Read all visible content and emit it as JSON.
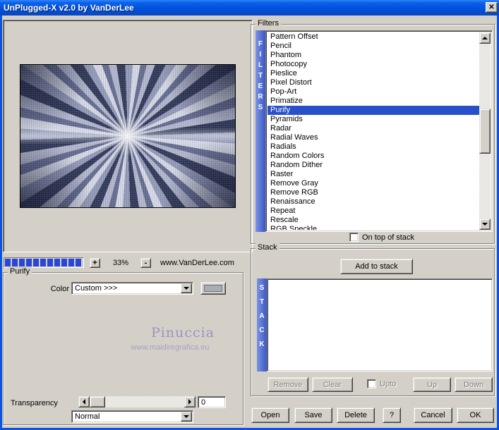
{
  "window": {
    "title": "UnPlugged-X v2.0 by VanDerLee",
    "close_icon": "✕"
  },
  "preview": {
    "zoom_in_label": "+",
    "zoom_level": "33%",
    "zoom_out_label": "-",
    "website": "www.VanDerLee.com"
  },
  "purify_panel": {
    "legend": "Purify",
    "color_label": "Color",
    "color_value": "Custom >>>",
    "watermark_title": "Pinuccia",
    "watermark_url": "www.maidiregrafica.eu",
    "transparency_label": "Transparency",
    "transparency_value": "0",
    "blend_mode": "Normal"
  },
  "filters_panel": {
    "legend": "Filters",
    "vertical_label": "FILTERS",
    "items": [
      "Pattern Offset",
      "Pencil",
      "Phantom",
      "Photocopy",
      "Pieslice",
      "Pixel Distort",
      "Pop-Art",
      "Primatize",
      "Purify",
      "Pyramids",
      "Radar",
      "Radial Waves",
      "Radials",
      "Random Colors",
      "Random Dither",
      "Raster",
      "Remove Gray",
      "Remove RGB",
      "Renaissance",
      "Repeat",
      "Rescale",
      "RGB Speckle"
    ],
    "selected": "Purify",
    "on_top_label": "On top of stack"
  },
  "stack_panel": {
    "legend": "Stack",
    "add_button": "Add to stack",
    "vertical_label": "STACK",
    "remove_button": "Remove",
    "clear_button": "Clear",
    "upto_label": "Upto",
    "up_button": "Up",
    "down_button": "Down"
  },
  "footer": {
    "open": "Open",
    "save": "Save",
    "delete": "Delete",
    "help": "?",
    "cancel": "Cancel",
    "ok": "OK"
  },
  "colors": {
    "titlebar_blue": "#0a53dd",
    "selection_blue": "#2850c8",
    "strip_blue": "#4a6cd4",
    "progress_blue": "#2946d8",
    "watermark_purple": "#9c92c2",
    "swatch_gray": "#a9aeb6",
    "window_gray": "#d4d0c8"
  }
}
